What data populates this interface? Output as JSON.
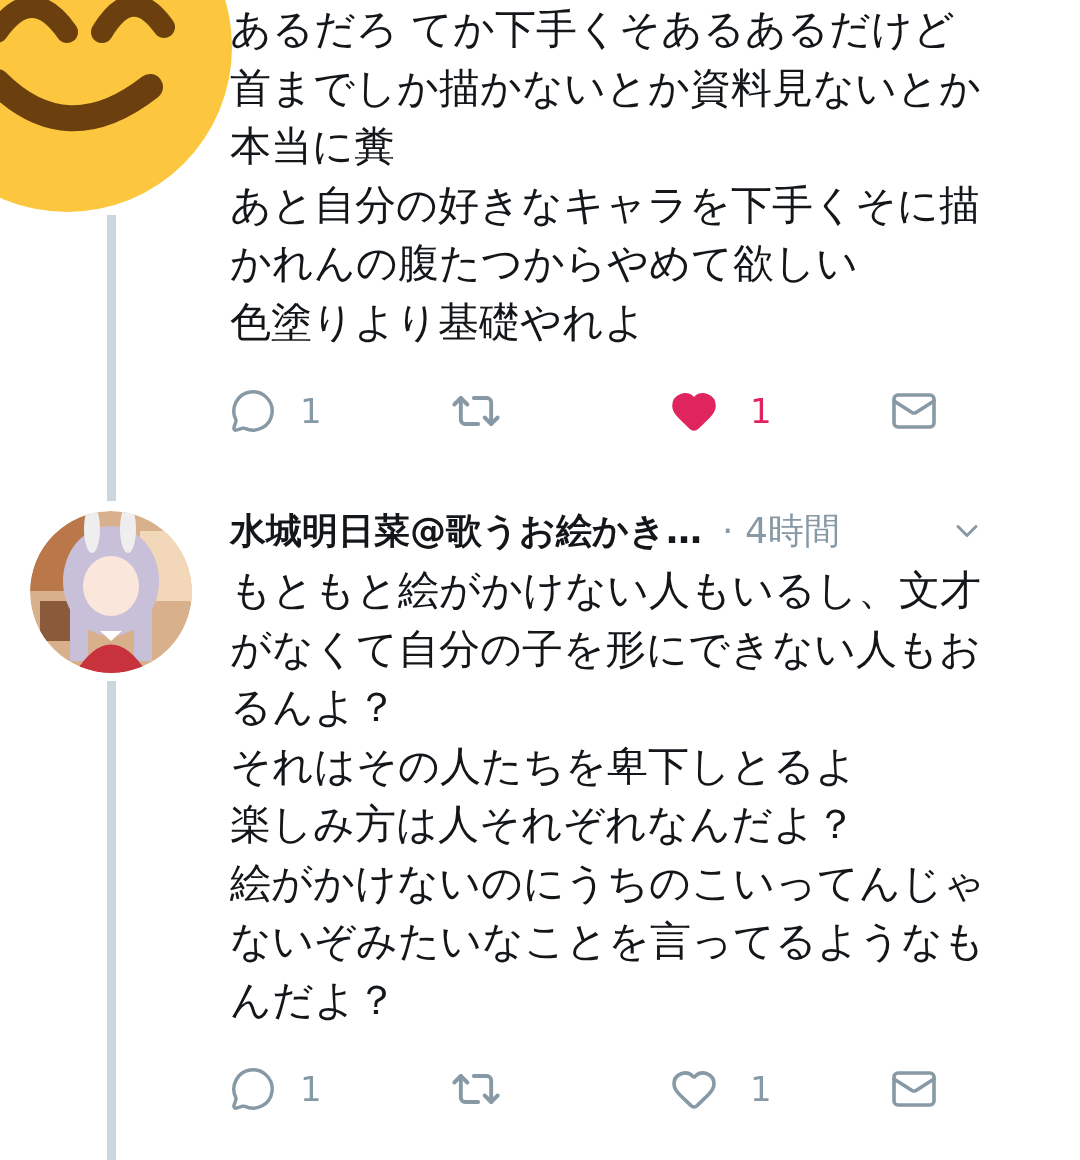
{
  "tweets": [
    {
      "avatar": {
        "kind": "emoji"
      },
      "lines": [
        "あるだろ てか下手くそあるあるだけど",
        "首までしか描かないとか資料見ないとか",
        "本当に糞",
        "あと自分の好きなキャラを下手くそに描",
        "かれんの腹たつからやめて欲しい",
        "色塗りより基礎やれよ"
      ],
      "actions": {
        "replies": "1",
        "likes": "1",
        "liked": true
      }
    },
    {
      "author": "水城明日菜@歌うお絵かき…",
      "time": "· 4時間",
      "lines": [
        "もともと絵がかけない人もいるし、文才",
        "がなくて自分の子を形にできない人もお",
        "るんよ？",
        "それはその人たちを卑下しとるよ",
        "楽しみ方は人それぞれなんだよ？",
        "絵がかけないのにうちのこいってんじゃ",
        "ないぞみたいなことを言ってるようなも",
        "んだよ？"
      ],
      "actions": {
        "replies": "1",
        "likes": "1",
        "liked": false
      }
    }
  ]
}
